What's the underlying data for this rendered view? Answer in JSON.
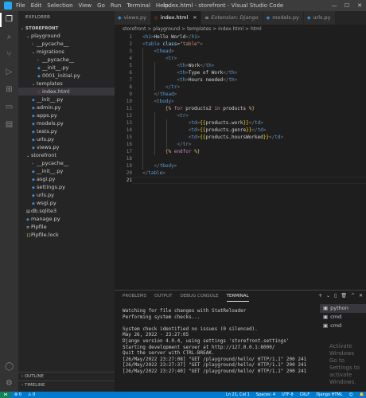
{
  "titlebar": {
    "menu": [
      "File",
      "Edit",
      "Selection",
      "View",
      "Go",
      "Run",
      "Terminal",
      "Help"
    ],
    "title": "index.html - storefront - Visual Studio Code"
  },
  "explorer": {
    "title": "EXPLORER",
    "tree": [
      {
        "label": "STOREFRONT",
        "depth": 0,
        "kind": "root",
        "expanded": true
      },
      {
        "label": "playground",
        "depth": 1,
        "kind": "folder",
        "expanded": true
      },
      {
        "label": "__pycache__",
        "depth": 2,
        "kind": "folder",
        "expanded": false
      },
      {
        "label": "migrations",
        "depth": 2,
        "kind": "folder",
        "expanded": true
      },
      {
        "label": "__pycache__",
        "depth": 3,
        "kind": "folder",
        "expanded": false
      },
      {
        "label": "__init__.py",
        "depth": 3,
        "kind": "py"
      },
      {
        "label": "0001_initial.py",
        "depth": 3,
        "kind": "py"
      },
      {
        "label": "templates",
        "depth": 2,
        "kind": "folder",
        "expanded": true
      },
      {
        "label": "index.html",
        "depth": 3,
        "kind": "html",
        "selected": true
      },
      {
        "label": "__init__.py",
        "depth": 2,
        "kind": "py"
      },
      {
        "label": "admin.py",
        "depth": 2,
        "kind": "py"
      },
      {
        "label": "apps.py",
        "depth": 2,
        "kind": "py"
      },
      {
        "label": "models.py",
        "depth": 2,
        "kind": "py"
      },
      {
        "label": "tests.py",
        "depth": 2,
        "kind": "py"
      },
      {
        "label": "urls.py",
        "depth": 2,
        "kind": "py"
      },
      {
        "label": "views.py",
        "depth": 2,
        "kind": "py"
      },
      {
        "label": "storefront",
        "depth": 1,
        "kind": "folder",
        "expanded": true
      },
      {
        "label": "__pycache__",
        "depth": 2,
        "kind": "folder",
        "expanded": false
      },
      {
        "label": "__init__.py",
        "depth": 2,
        "kind": "py"
      },
      {
        "label": "asgi.py",
        "depth": 2,
        "kind": "py"
      },
      {
        "label": "settings.py",
        "depth": 2,
        "kind": "py"
      },
      {
        "label": "urls.py",
        "depth": 2,
        "kind": "py"
      },
      {
        "label": "wsgi.py",
        "depth": 2,
        "kind": "py"
      },
      {
        "label": "db.sqlite3",
        "depth": 1,
        "kind": "db"
      },
      {
        "label": "manage.py",
        "depth": 1,
        "kind": "py"
      },
      {
        "label": "Pipfile",
        "depth": 1,
        "kind": "txt"
      },
      {
        "label": "Pipfile.lock",
        "depth": 1,
        "kind": "json"
      }
    ],
    "outline_label": "OUTLINE",
    "timeline_label": "TIMELINE"
  },
  "tabs": [
    {
      "label": "views.py",
      "icon": "py",
      "active": false,
      "italic": false
    },
    {
      "label": "index.html",
      "icon": "html",
      "active": true,
      "italic": false
    },
    {
      "label": "Extension: Django",
      "icon": "ext",
      "active": false,
      "italic": true
    },
    {
      "label": "models.py",
      "icon": "py",
      "active": false,
      "italic": false
    },
    {
      "label": "urls.py",
      "icon": "py",
      "active": false,
      "italic": false
    }
  ],
  "breadcrumb": "storefront > playground > templates > index.html > html",
  "editor": {
    "current_line": 21,
    "lines": [
      {
        "n": "1",
        "tokens": [
          [
            "br",
            "<"
          ],
          [
            "tag",
            "h1"
          ],
          [
            "br",
            ">"
          ],
          [
            "txt",
            "Hello World"
          ],
          [
            "br",
            "</"
          ],
          [
            "tag",
            "h1"
          ],
          [
            "br",
            ">"
          ]
        ]
      },
      {
        "n": "2",
        "tokens": [
          [
            "br",
            "<"
          ],
          [
            "tag",
            "table"
          ],
          [
            "txt",
            " "
          ],
          [
            "attr",
            "class"
          ],
          [
            "txt",
            "="
          ],
          [
            "str",
            "\"table\""
          ],
          [
            "br",
            ">"
          ]
        ]
      },
      {
        "n": "3",
        "tokens": [
          [
            "txt",
            "    "
          ],
          [
            "br",
            "<"
          ],
          [
            "tag",
            "thead"
          ],
          [
            "br",
            ">"
          ]
        ]
      },
      {
        "n": "4",
        "tokens": [
          [
            "txt",
            "        "
          ],
          [
            "br",
            "<"
          ],
          [
            "tag",
            "tr"
          ],
          [
            "br",
            ">"
          ]
        ]
      },
      {
        "n": "5",
        "tokens": [
          [
            "txt",
            "            "
          ],
          [
            "br",
            "<"
          ],
          [
            "tag",
            "th"
          ],
          [
            "br",
            ">"
          ],
          [
            "txt",
            "Work"
          ],
          [
            "br",
            "</"
          ],
          [
            "tag",
            "th"
          ],
          [
            "br",
            ">"
          ]
        ]
      },
      {
        "n": "6",
        "tokens": [
          [
            "txt",
            "            "
          ],
          [
            "br",
            "<"
          ],
          [
            "tag",
            "th"
          ],
          [
            "br",
            ">"
          ],
          [
            "txt",
            "Type of Work"
          ],
          [
            "br",
            "</"
          ],
          [
            "tag",
            "th"
          ],
          [
            "br",
            ">"
          ]
        ]
      },
      {
        "n": "7",
        "tokens": [
          [
            "txt",
            "            "
          ],
          [
            "br",
            "<"
          ],
          [
            "tag",
            "th"
          ],
          [
            "br",
            ">"
          ],
          [
            "txt",
            "Hours needed"
          ],
          [
            "br",
            "</"
          ],
          [
            "tag",
            "th"
          ],
          [
            "br",
            ">"
          ]
        ]
      },
      {
        "n": "8",
        "tokens": [
          [
            "txt",
            "        "
          ],
          [
            "br",
            "</"
          ],
          [
            "tag",
            "tr"
          ],
          [
            "br",
            ">"
          ]
        ]
      },
      {
        "n": "9",
        "tokens": [
          [
            "txt",
            "    "
          ],
          [
            "br",
            "</"
          ],
          [
            "tag",
            "thead"
          ],
          [
            "br",
            ">"
          ]
        ]
      },
      {
        "n": "10",
        "tokens": [
          [
            "txt",
            "    "
          ],
          [
            "br",
            "<"
          ],
          [
            "tag",
            "tbody"
          ],
          [
            "br",
            ">"
          ]
        ]
      },
      {
        "n": "11",
        "tokens": [
          [
            "txt",
            "        "
          ],
          [
            "tpl",
            "{%"
          ],
          [
            "kw",
            " for"
          ],
          [
            "txt",
            " products2 "
          ],
          [
            "kw",
            "in"
          ],
          [
            "txt",
            " products "
          ],
          [
            "tpl",
            "%}"
          ]
        ]
      },
      {
        "n": "12",
        "tokens": [
          [
            "txt",
            "            "
          ],
          [
            "br",
            "<"
          ],
          [
            "tag",
            "tr"
          ],
          [
            "br",
            ">"
          ]
        ]
      },
      {
        "n": "13",
        "tokens": [
          [
            "txt",
            "                "
          ],
          [
            "br",
            "<"
          ],
          [
            "tag",
            "td"
          ],
          [
            "br",
            ">"
          ],
          [
            "var",
            "{{"
          ],
          [
            "txt",
            "products.work"
          ],
          [
            "var",
            "}}"
          ],
          [
            "br",
            "</"
          ],
          [
            "tag",
            "td"
          ],
          [
            "br",
            ">"
          ]
        ]
      },
      {
        "n": "14",
        "tokens": [
          [
            "txt",
            "                "
          ],
          [
            "br",
            "<"
          ],
          [
            "tag",
            "td"
          ],
          [
            "br",
            ">"
          ],
          [
            "var",
            "{{"
          ],
          [
            "txt",
            "products.genre"
          ],
          [
            "var",
            "}}"
          ],
          [
            "br",
            "</"
          ],
          [
            "tag",
            "td"
          ],
          [
            "br",
            ">"
          ]
        ]
      },
      {
        "n": "15",
        "tokens": [
          [
            "txt",
            "                "
          ],
          [
            "br",
            "<"
          ],
          [
            "tag",
            "td"
          ],
          [
            "br",
            ">"
          ],
          [
            "var",
            "{{"
          ],
          [
            "txt",
            "products.hoursWorked"
          ],
          [
            "var",
            "}}"
          ],
          [
            "br",
            "</"
          ],
          [
            "tag",
            "td"
          ],
          [
            "br",
            ">"
          ]
        ]
      },
      {
        "n": "16",
        "tokens": [
          [
            "txt",
            "            "
          ],
          [
            "br",
            "</"
          ],
          [
            "tag",
            "tr"
          ],
          [
            "br",
            ">"
          ]
        ]
      },
      {
        "n": "17",
        "tokens": [
          [
            "txt",
            "        "
          ],
          [
            "tpl",
            "{%"
          ],
          [
            "kw",
            " endfor"
          ],
          [
            "txt",
            " "
          ],
          [
            "tpl",
            "%}"
          ]
        ]
      },
      {
        "n": "18",
        "tokens": []
      },
      {
        "n": "19",
        "tokens": [
          [
            "txt",
            "    "
          ],
          [
            "br",
            "</"
          ],
          [
            "tag",
            "tbody"
          ],
          [
            "br",
            ">"
          ]
        ]
      },
      {
        "n": "20",
        "tokens": [
          [
            "br",
            "</"
          ],
          [
            "tag",
            "table"
          ],
          [
            "br",
            ">"
          ]
        ]
      },
      {
        "n": "21",
        "tokens": []
      }
    ]
  },
  "panel": {
    "tabs": [
      "PROBLEMS",
      "OUTPUT",
      "DEBUG CONSOLE",
      "TERMINAL"
    ],
    "active_tab": "TERMINAL",
    "terminal_lines": [
      "Watching for file changes with StatReloader",
      "Performing system checks...",
      "",
      "System check identified no issues (0 silenced).",
      "May 26, 2022 - 23:27:05",
      "Django version 4.0.4, using settings 'storefront.settings'",
      "Starting development server at http://127.0.0.1:8000/",
      "Quit the server with CTRL-BREAK.",
      "[26/May/2022 23:27:08] \"GET /playground/hello/ HTTP/1.1\" 200 241",
      "[26/May/2022 23:27:37] \"GET /playground/hello/ HTTP/1.1\" 200 241",
      "[26/May/2022 23:27:40] \"GET /playground/hello/ HTTP/1.1\" 200 241"
    ],
    "terminals": [
      {
        "label": "python",
        "selected": true
      },
      {
        "label": "cmd",
        "selected": false
      },
      {
        "label": "cmd",
        "selected": false
      }
    ],
    "watermark": [
      "Activate Windows",
      "Go to Settings to activate Windows."
    ]
  },
  "statusbar": {
    "errors": "⊗ 0",
    "warnings": "⚠ 0",
    "position": "Ln 21, Col 1",
    "spaces": "Spaces: 4",
    "encoding": "UTF-8",
    "eol": "CRLF",
    "language": "Django HTML"
  },
  "colors": {
    "accent": "#007acc",
    "tag": "#569cd6",
    "attr": "#9cdcfe",
    "string": "#ce9178",
    "keyword": "#c586c0",
    "template": "#d7ba7d",
    "variable": "#ffd700"
  }
}
